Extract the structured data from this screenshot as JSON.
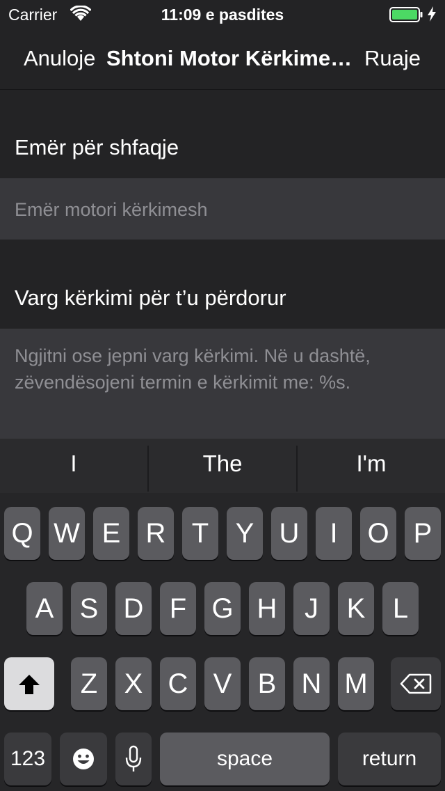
{
  "status_bar": {
    "carrier": "Carrier",
    "time": "11:09 e pasdites"
  },
  "nav": {
    "cancel": "Anuloje",
    "title": "Shtoni Motor Kërkimesh",
    "save": "Ruaje"
  },
  "form": {
    "name_section_label": "Emër për shfaqje",
    "name_placeholder": "Emër motori kërkimesh",
    "url_section_label": "Varg kërkimi për t’u përdorur",
    "url_placeholder_line1": "Ngjitni ose jepni varg kërkimi. Në u dashtë,",
    "url_placeholder_line2": "zëvendësojeni termin e kërkimit me: %s."
  },
  "suggestions": [
    "I",
    "The",
    "I'm"
  ],
  "keyboard": {
    "row1": [
      "Q",
      "W",
      "E",
      "R",
      "T",
      "Y",
      "U",
      "I",
      "O",
      "P"
    ],
    "row2": [
      "A",
      "S",
      "D",
      "F",
      "G",
      "H",
      "J",
      "K",
      "L"
    ],
    "row3": [
      "Z",
      "X",
      "C",
      "V",
      "B",
      "N",
      "M"
    ],
    "numbers_label": "123",
    "space_label": "space",
    "return_label": "return"
  },
  "colors": {
    "background": "#232325",
    "field": "#38383c",
    "key": "#5b5b5f",
    "battery": "#4cd964"
  }
}
